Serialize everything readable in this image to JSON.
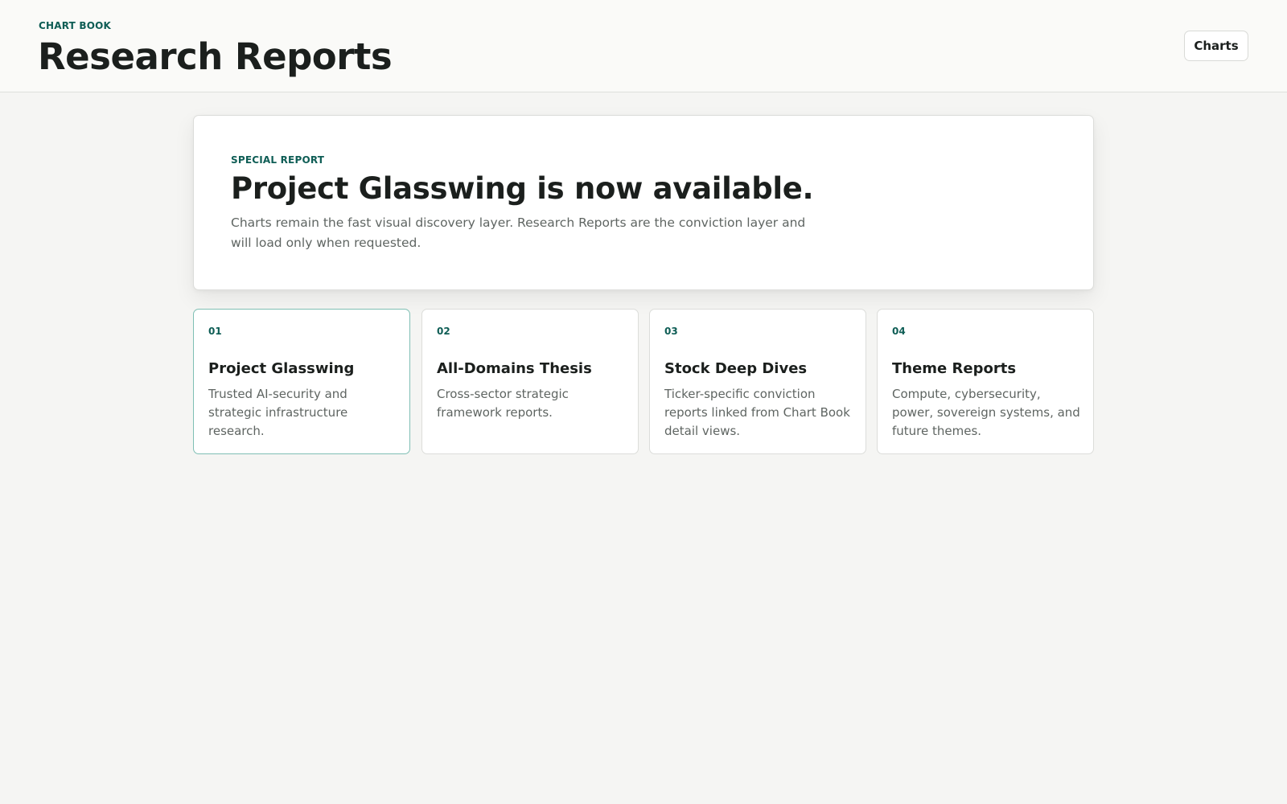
{
  "header": {
    "eyebrow": "CHART BOOK",
    "title": "Research Reports",
    "charts_button": "Charts"
  },
  "hero": {
    "eyebrow": "SPECIAL REPORT",
    "title": "Project Glasswing is now available.",
    "description": "Charts remain the fast visual discovery layer. Research Reports are the conviction layer and will load only when requested."
  },
  "cards": [
    {
      "number": "01",
      "title": "Project Glasswing",
      "description": "Trusted AI-security and strategic infrastructure research.",
      "selected": true
    },
    {
      "number": "02",
      "title": "All-Domains Thesis",
      "description": "Cross-sector strategic framework reports.",
      "selected": false
    },
    {
      "number": "03",
      "title": "Stock Deep Dives",
      "description": "Ticker-specific conviction reports linked from Chart Book detail views.",
      "selected": false
    },
    {
      "number": "04",
      "title": "Theme Reports",
      "description": "Compute, cybersecurity, power, sovereign systems, and future themes.",
      "selected": false
    }
  ],
  "colors": {
    "accent": "#0e5d55",
    "selected_border": "#7fbfb4",
    "background": "#f5f5f3",
    "header_background": "#fafaf8",
    "card_background": "#ffffff",
    "heading_text": "#1b1f1d",
    "body_text": "#5f6562"
  }
}
